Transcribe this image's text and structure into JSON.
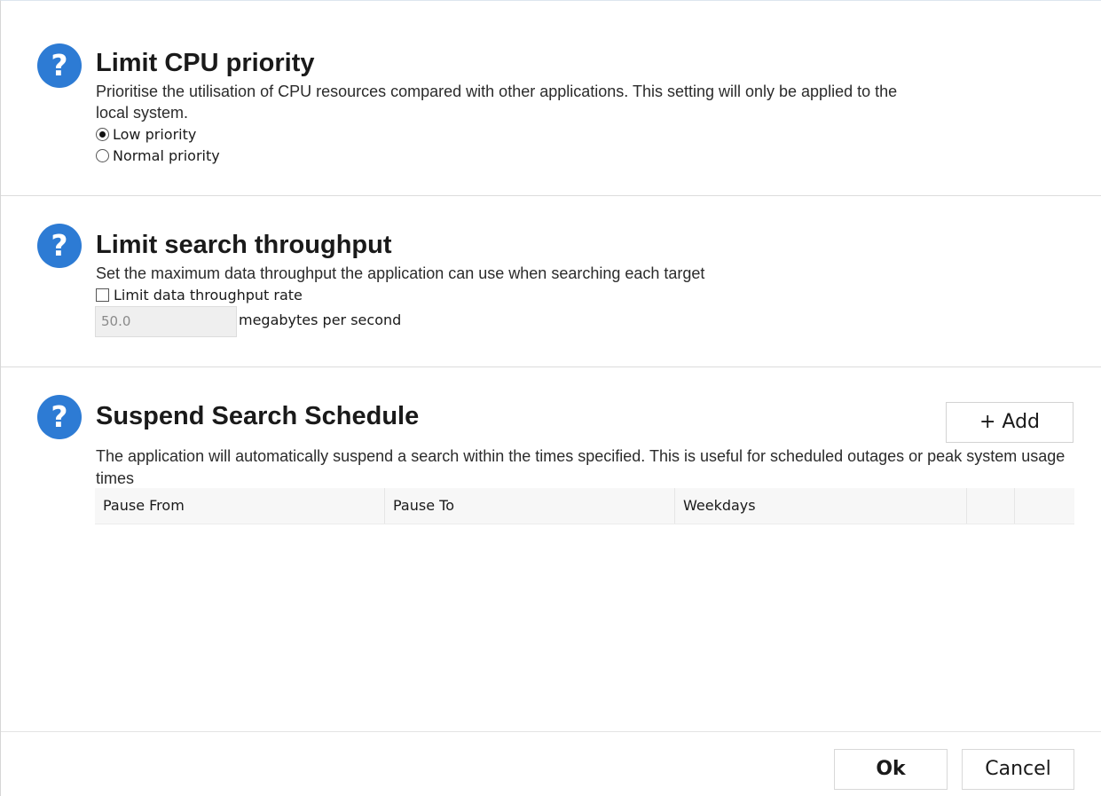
{
  "cpu": {
    "title": "Limit CPU priority",
    "description": "Prioritise the utilisation of CPU resources compared with other applications. This setting will only be applied to the local system.",
    "options": [
      {
        "label": "Low priority",
        "selected": true
      },
      {
        "label": "Normal priority",
        "selected": false
      }
    ]
  },
  "throughput": {
    "title": "Limit search throughput",
    "description": "Set the maximum data throughput the application can use when searching each target",
    "checkbox_label": "Limit data throughput rate",
    "checkbox_checked": false,
    "rate_value": "50.0",
    "rate_unit": "megabytes per second"
  },
  "schedule": {
    "title": "Suspend Search Schedule",
    "add_label": "+ Add",
    "description": "The application will automatically suspend a search within the times specified. This is useful for scheduled outages or peak system usage times",
    "columns": [
      "Pause From",
      "Pause To",
      "Weekdays"
    ]
  },
  "footer": {
    "ok_label": "Ok",
    "cancel_label": "Cancel"
  },
  "icons": {
    "help": "help-icon",
    "help_glyph": "?"
  },
  "colors": {
    "help_icon": "#2d7bd4"
  }
}
